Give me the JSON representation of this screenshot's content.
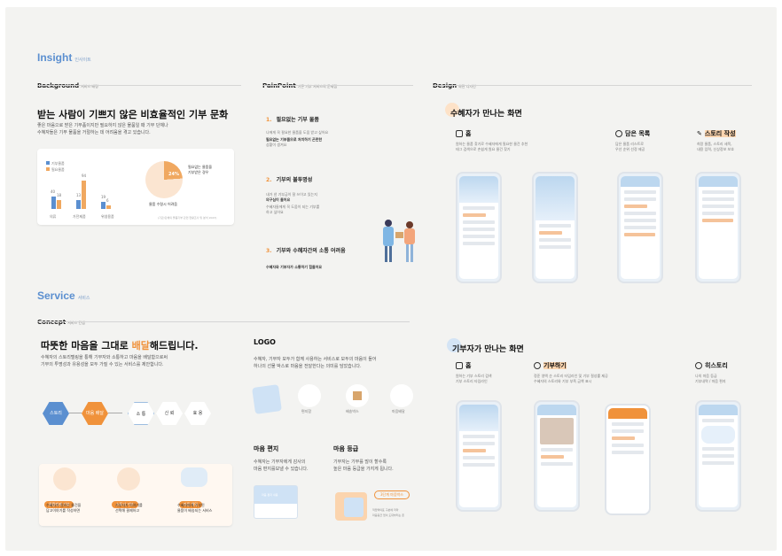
{
  "insight": {
    "title": "Insight",
    "sub": "인사이트"
  },
  "background": {
    "label": "Background",
    "sub": "서비스 배경",
    "headline": "받는 사람이 기쁘지 않은 비효율적인 기부 문화",
    "desc1": "좋은 마음으로 받은 기부품이지만 필요하지 않은 물품일 때 기부 단체나",
    "desc2": "수혜자들은 기부 물품을 거절하는 데 어려움을 겪고 있습니다.",
    "legend": [
      "기부물품",
      "필요물품"
    ],
    "groups": [
      {
        "name": "의류",
        "v": [
          "40",
          "18"
        ]
      },
      {
        "name": "가전제품",
        "v": [
          "13",
          "94"
        ]
      },
      {
        "name": "위생용품",
        "v": [
          "19",
          "6"
        ]
      }
    ],
    "pie_value": "24%",
    "pie_caption1": "필요없는 물품을",
    "pie_caption2": "기부받은 경우",
    "pie_caption3": "물품 수령시 어려움",
    "source": "(기관/단체의 물품기부 관련 현황조사 및 분석 2023)"
  },
  "painpoint": {
    "label": "PainPoint",
    "sub": "기존 기부 서비스의 문제점",
    "items": [
      {
        "n": "1.",
        "h": "필요없는 기부 물품",
        "l": [
          "나에게 꼭 필요한 물품을 도움 받고 싶어요",
          "필요없는 기부품으로 처치하기 곤란한",
          "상황이 생겨요"
        ]
      },
      {
        "n": "2.",
        "h": "기부의 불투명성",
        "l": [
          "내가 낸 기부금이 잘 쓰이고 있는지",
          "의구심이 들어요",
          "수혜자들에게 꼭 도움이 되는 기부를",
          "하고 싶어요"
        ]
      },
      {
        "n": "3.",
        "h": "기부와 수혜자간의 소통 어려움",
        "l": [
          "수혜자와 기부자가 소통하기 힘들어요"
        ]
      }
    ]
  },
  "design": {
    "label": "Design",
    "sub": "화면 디자인",
    "recv": "수혜자가 만나는 화면",
    "recv_cols": [
      {
        "h": "홈",
        "d": [
          "원하는 물품 찾기로 수혜자에게 필요한 물건 추천",
          "테그 검색으로 손쉽게 원요 물건 찾기"
        ]
      },
      {
        "h": "담은 목록",
        "d": [
          "담은 물품 리스트로",
          "우선 순위 선정 제공"
        ]
      },
      {
        "h": "스토리 작성",
        "d": [
          "희망 물품, 스토리 세목,",
          "내용 입력, 신상정보 보호"
        ]
      }
    ],
    "give": "기부자가 만나는 화면",
    "give_cols": [
      {
        "h": "홈",
        "d": [
          "원하는 기부 스토리 검색",
          "기부 스토리 타임라인"
        ]
      },
      {
        "h": "기부하기",
        "d": [
          "정준 영액 순 스토리 타임라인 및 기부 절성률 제공",
          "수혜자의 스토리와 기부 부족 금액 표시"
        ]
      },
      {
        "h": "히스토리",
        "d": [
          "나의 마음 등급",
          "기부내역 / 마음 편지"
        ]
      }
    ]
  },
  "service": {
    "title": "Service",
    "sub": "서비스"
  },
  "concept": {
    "label": "Concept",
    "sub": "서비스 컨셉",
    "headline_a": "따뜻한 마음을 그대로 ",
    "headline_b": "배달",
    "headline_c": "해드립니다.",
    "desc1": "수혜자의 스토리텔링을 통해 기부자와 소통하고 마음을 배달함으로써",
    "desc2": "기부의 투명성과 유용성을 모두 가질 수 있는 서비스를 제안합니다.",
    "hex": [
      "스토리",
      "마음 배달",
      "소 통",
      "신 뢰",
      "효 용"
    ],
    "steps": [
      {
        "tag": "물품에게 기부",
        "d": [
          "수혜자가 원하는 물건을",
          "담고이야기를 작성하면"
        ]
      },
      {
        "tag": "스토리 기부",
        "d": [
          "기부자가 이야기를",
          "선택해 결제하고"
        ]
      },
      {
        "tag": "마음 배달",
        "d": [
          "수혜자에게 기부된",
          "물품이 배송되는 서비스"
        ]
      }
    ]
  },
  "logo": {
    "label": "LOGO",
    "d1": "수혜자, 기부자 모두가 함께 사용하는 서비스로 모두의 마음이 들어",
    "d2": "하나의 선물 박스로 마음을 전달한다는 의미를 담았습니다.",
    "marks": [
      "편지함",
      "배송박스",
      "마음배달"
    ]
  },
  "letter": {
    "h": "마음 편지",
    "d1": "수혜자는 기부자에게 감사의",
    "d2": "마음 편지를보낼 수 있습니다.",
    "card": "마음 편지 내용"
  },
  "grade": {
    "h": "마음 등급",
    "d1": "기부자는 기부를 많이 할수록",
    "d2": "높은 마음 등급을 가지게 됩니다.",
    "badge": "3단계 마음박스",
    "f1": "적립액의표 구분에 따라",
    "f2": "마음등급 업이 도대부터는 존"
  },
  "colors": {
    "accent": "#f0923b",
    "blue": "#5b8fd0",
    "light": "#cfe2f5"
  }
}
